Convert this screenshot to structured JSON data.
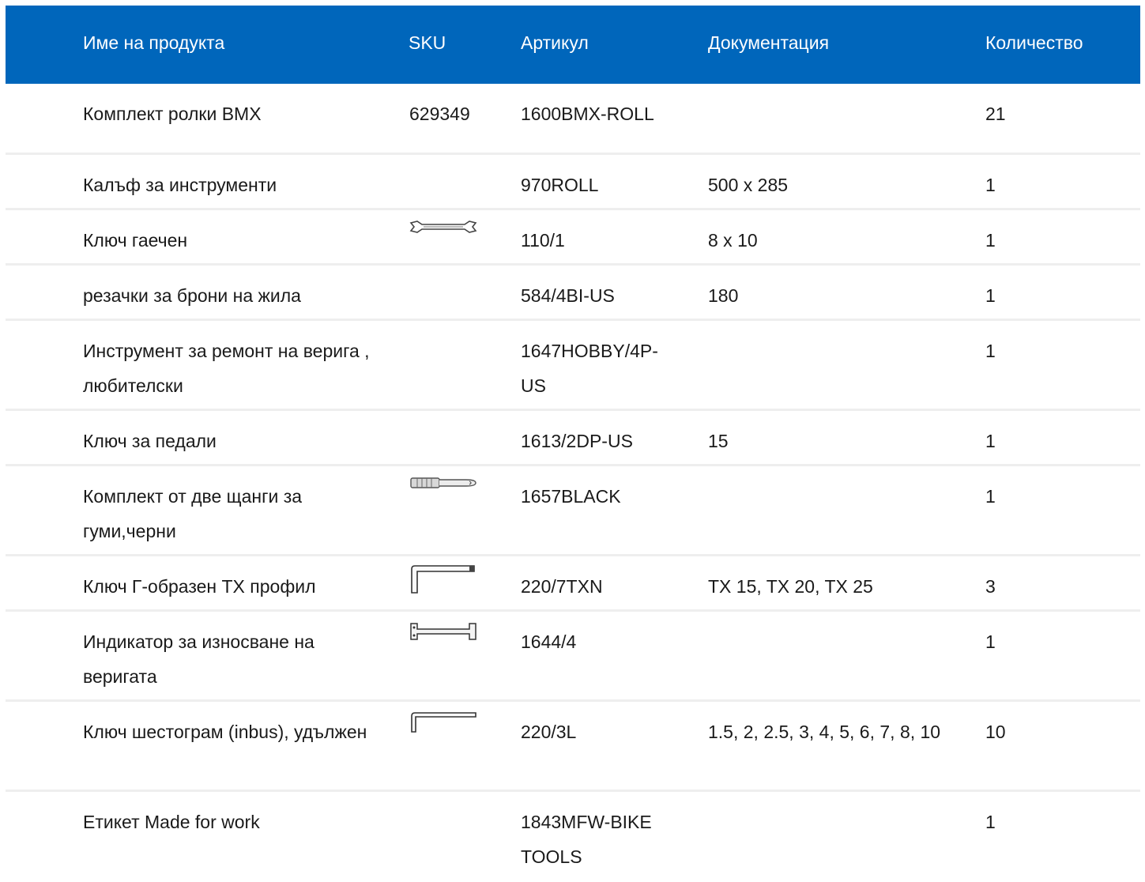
{
  "table": {
    "headers": {
      "name": "Име на продукта",
      "sku": "SKU",
      "article": "Артикул",
      "documentation": "Документация",
      "quantity": "Количество"
    },
    "rows": [
      {
        "name": "Комплект ролки BMX",
        "sku": "629349",
        "article": "1600BMX-ROLL",
        "documentation": "",
        "quantity": "21",
        "icon": ""
      },
      {
        "name": "Калъф за инструменти",
        "sku": "",
        "article": "970ROLL",
        "documentation": "500 x 285",
        "quantity": "1",
        "icon": ""
      },
      {
        "name": "Ключ гаечен",
        "sku": "",
        "article": "110/1",
        "documentation": "8 x 10",
        "quantity": "1",
        "icon": "open-end-wrench-icon"
      },
      {
        "name": "резачки за брони на жила",
        "sku": "",
        "article": "584/4BI-US",
        "documentation": "180",
        "quantity": "1",
        "icon": ""
      },
      {
        "name": "Инструмент за ремонт на верига , любителски",
        "sku": "",
        "article": "1647HOBBY/4P-US",
        "documentation": "",
        "quantity": "1",
        "icon": ""
      },
      {
        "name": "Ключ за педали",
        "sku": "",
        "article": "1613/2DP-US",
        "documentation": "15",
        "quantity": "1",
        "icon": ""
      },
      {
        "name": "Комплект от две щанги за гуми,черни",
        "sku": "",
        "article": "1657BLACK",
        "documentation": "",
        "quantity": "1",
        "icon": "tire-lever-icon"
      },
      {
        "name": "Ключ Г-образен TX профил",
        "sku": "",
        "article": "220/7TXN",
        "documentation": "TX 15, TX 20, TX 25",
        "quantity": "3",
        "icon": "l-key-torx-icon"
      },
      {
        "name": "Индикатор за износване на веригата",
        "sku": "",
        "article": "1644/4",
        "documentation": "",
        "quantity": "1",
        "icon": "chain-wear-indicator-icon"
      },
      {
        "name": "Ключ шестограм (inbus), удължен",
        "sku": "",
        "article": "220/3L",
        "documentation": "1.5, 2, 2.5, 3, 4, 5, 6, 7, 8, 10",
        "quantity": "10",
        "icon": "hex-key-long-icon"
      },
      {
        "name": "Етикет Made for work",
        "sku": "",
        "article": "1843MFW-BIKE TOOLS",
        "documentation": "",
        "quantity": "1",
        "icon": ""
      }
    ]
  },
  "colors": {
    "header_bg": "#0066bb",
    "header_text": "#ffffff",
    "row_divider": "#eeeeee"
  }
}
